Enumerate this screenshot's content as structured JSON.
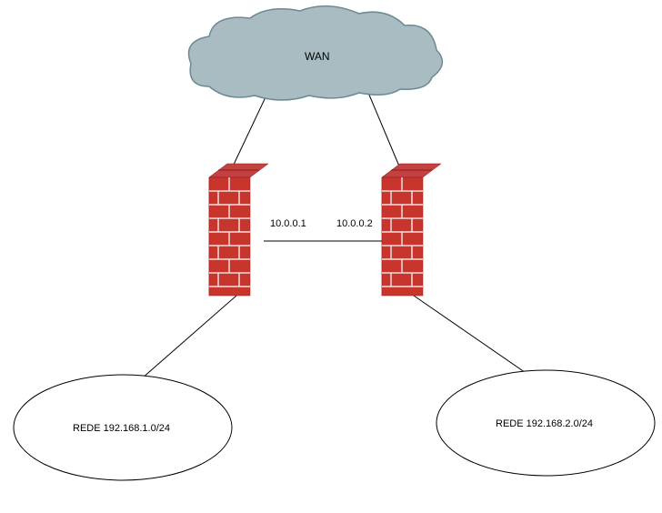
{
  "diagram": {
    "cloud": {
      "label": "WAN"
    },
    "firewall1": {
      "ip": "10.0.0.1"
    },
    "firewall2": {
      "ip": "10.0.0.2"
    },
    "network1": {
      "label": "REDE 192.168.1.0/24"
    },
    "network2": {
      "label": "REDE 192.168.2.0/24"
    }
  }
}
